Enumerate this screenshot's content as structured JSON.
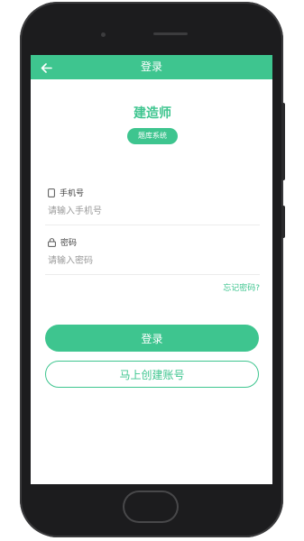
{
  "header": {
    "title": "登录"
  },
  "logo": {
    "title": "建造师",
    "subtitle": "题库系统"
  },
  "form": {
    "phone_label": "手机号",
    "phone_placeholder": "请输入手机号",
    "password_label": "密码",
    "password_placeholder": "请输入密码",
    "forgot_link": "忘记密码?"
  },
  "actions": {
    "login_label": "登录",
    "register_label": "马上创建账号"
  },
  "colors": {
    "accent": "#3ec58f",
    "device": "#1c1c1e"
  },
  "icons": {
    "back": "arrow-left-icon",
    "phone": "phone-icon",
    "lock": "lock-icon"
  }
}
